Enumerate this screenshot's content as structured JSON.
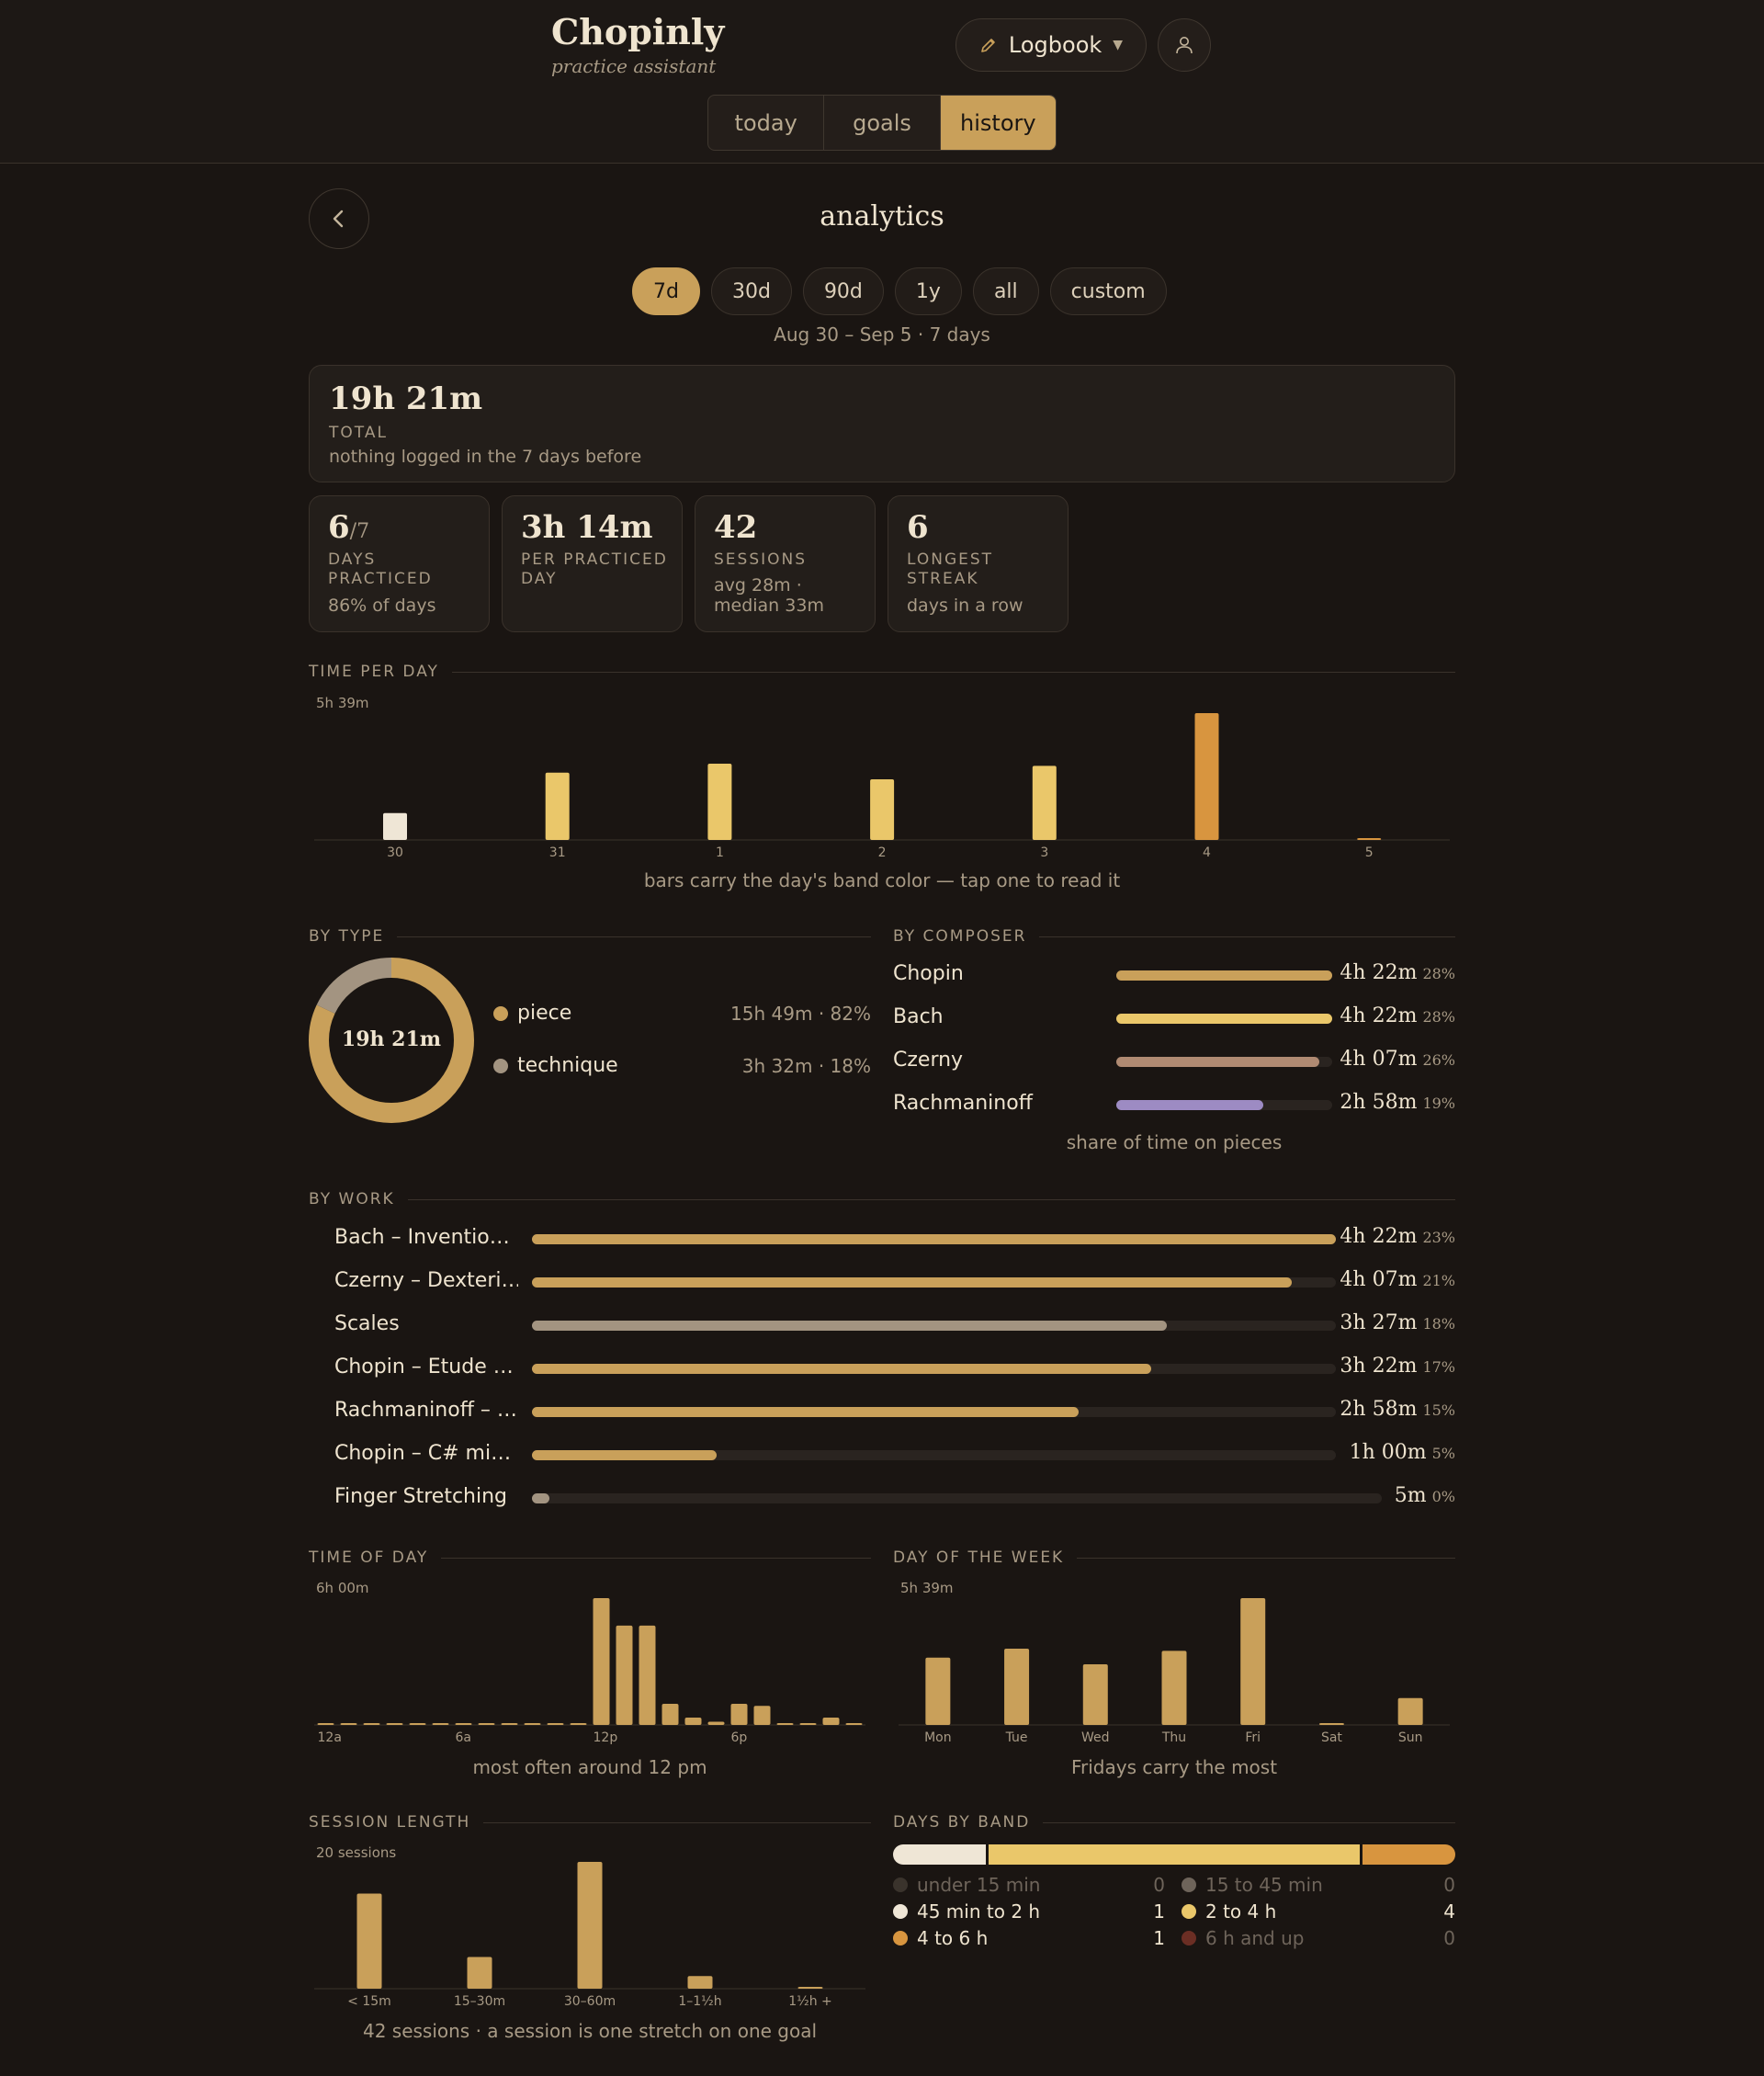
{
  "app": {
    "title": "Chopinly",
    "subtitle": "practice assistant"
  },
  "header": {
    "logbook_label": "Logbook",
    "tabs": [
      "today",
      "goals",
      "history"
    ],
    "active_tab": "history"
  },
  "page": {
    "title": "analytics",
    "range_options": [
      "7d",
      "30d",
      "90d",
      "1y",
      "all",
      "custom"
    ],
    "active_range": "7d",
    "date_range": "Aug 30 – Sep 5 · 7 days"
  },
  "total": {
    "value": "19h 21m",
    "label": "TOTAL",
    "note": "nothing logged in the 7 days before"
  },
  "stats": [
    {
      "value": "6",
      "suffix": "/7",
      "label": "DAYS PRACTICED",
      "note": "86% of days"
    },
    {
      "value": "3h 14m",
      "suffix": "",
      "label": "PER PRACTICED DAY",
      "note": ""
    },
    {
      "value": "42",
      "suffix": "",
      "label": "SESSIONS",
      "note": "avg 28m · median 33m"
    },
    {
      "value": "6",
      "suffix": "",
      "label": "LONGEST STREAK",
      "note": "days in a row"
    }
  ],
  "time_per_day": {
    "title": "TIME PER DAY",
    "max_label": "5h 39m",
    "caption": "bars carry the day's band color — tap one to read it",
    "chart_data": {
      "type": "bar",
      "categories": [
        "30",
        "31",
        "1",
        "2",
        "3",
        "4",
        "5"
      ],
      "values": [
        1.2,
        3.0,
        3.4,
        2.7,
        3.3,
        5.65,
        0.05
      ],
      "ylim": [
        0,
        5.65
      ],
      "colors": [
        "#efe6d6",
        "#eac76a",
        "#eac76a",
        "#eac76a",
        "#eac76a",
        "#d8953f",
        "#d8953f"
      ]
    }
  },
  "by_type": {
    "title": "BY TYPE",
    "center": "19h 21m",
    "items": [
      {
        "name": "piece",
        "value": "15h 49m · 82%",
        "color": "#c9a05a",
        "share": 82
      },
      {
        "name": "technique",
        "value": "3h 32m · 18%",
        "color": "#a39481",
        "share": 18
      }
    ]
  },
  "by_composer": {
    "title": "BY COMPOSER",
    "caption": "share of time on pieces",
    "items": [
      {
        "name": "Chopin",
        "time": "4h 22m",
        "pct": "28%",
        "fraction": 1.0,
        "color": "#c9a05a"
      },
      {
        "name": "Bach",
        "time": "4h 22m",
        "pct": "28%",
        "fraction": 1.0,
        "color": "#eac76a"
      },
      {
        "name": "Czerny",
        "time": "4h 07m",
        "pct": "26%",
        "fraction": 0.94,
        "color": "#b08a72"
      },
      {
        "name": "Rachmaninoff",
        "time": "2h 58m",
        "pct": "19%",
        "fraction": 0.68,
        "color": "#9d8bc3"
      }
    ]
  },
  "by_work": {
    "title": "BY WORK",
    "items": [
      {
        "name": "Bach – Inventio…",
        "time": "4h 22m",
        "pct": "23%",
        "fraction": 1.0,
        "color": "#c9a05a"
      },
      {
        "name": "Czerny – Dexteri…",
        "time": "4h 07m",
        "pct": "21%",
        "fraction": 0.945,
        "color": "#c9a05a"
      },
      {
        "name": "Scales",
        "time": "3h 27m",
        "pct": "18%",
        "fraction": 0.79,
        "color": "#a39481"
      },
      {
        "name": "Chopin – Etude …",
        "time": "3h 22m",
        "pct": "17%",
        "fraction": 0.77,
        "color": "#c9a05a"
      },
      {
        "name": "Rachmaninoff – …",
        "time": "2h 58m",
        "pct": "15%",
        "fraction": 0.68,
        "color": "#c9a05a"
      },
      {
        "name": "Chopin – C# mi…",
        "time": "1h 00m",
        "pct": "5%",
        "fraction": 0.23,
        "color": "#c9a05a"
      },
      {
        "name": "Finger Stretching",
        "time": "5m",
        "pct": "0%",
        "fraction": 0.02,
        "color": "#a39481"
      }
    ]
  },
  "time_of_day": {
    "title": "TIME OF DAY",
    "max_label": "6h 00m",
    "caption": "most often around 12 pm",
    "chart_data": {
      "type": "bar",
      "categories": [
        "12a",
        "1a",
        "2a",
        "3a",
        "4a",
        "5a",
        "6a",
        "7a",
        "8a",
        "9a",
        "10a",
        "11a",
        "12p",
        "1p",
        "2p",
        "3p",
        "4p",
        "5p",
        "6p",
        "7p",
        "8p",
        "9p",
        "10p",
        "11p"
      ],
      "tick_labels": {
        "0": "12a",
        "6": "6a",
        "12": "12p",
        "18": "6p"
      },
      "values": [
        0.05,
        0.05,
        0.05,
        0.05,
        0.05,
        0.05,
        0.05,
        0.05,
        0.05,
        0.05,
        0.05,
        0.05,
        6.0,
        4.7,
        4.7,
        1.0,
        0.35,
        0.15,
        1.0,
        0.9,
        0.05,
        0.05,
        0.35,
        0.05
      ],
      "ylim": [
        0,
        6.0
      ]
    }
  },
  "day_of_week": {
    "title": "DAY OF THE WEEK",
    "max_label": "5h 39m",
    "caption": "Fridays carry the most",
    "chart_data": {
      "type": "bar",
      "categories": [
        "Mon",
        "Tue",
        "Wed",
        "Thu",
        "Fri",
        "Sat",
        "Sun"
      ],
      "values": [
        3.0,
        3.4,
        2.7,
        3.3,
        5.65,
        0.05,
        1.2
      ],
      "ylim": [
        0,
        5.65
      ]
    }
  },
  "session_length": {
    "title": "SESSION LENGTH",
    "max_label": "20 sessions",
    "caption": "42 sessions · a session is one stretch on one goal",
    "chart_data": {
      "type": "bar",
      "categories": [
        "< 15m",
        "15–30m",
        "30–60m",
        "1–1½h",
        "1½h +"
      ],
      "values": [
        15,
        5,
        20,
        2,
        0.2
      ],
      "ylim": [
        0,
        20
      ]
    }
  },
  "days_by_band": {
    "title": "DAYS BY BAND",
    "bar": [
      {
        "fraction": 0.1667,
        "color": "#efe6d6"
      },
      {
        "fraction": 0.6667,
        "color": "#eac76a"
      },
      {
        "fraction": 0.1667,
        "color": "#d8953f"
      }
    ],
    "items": [
      {
        "name": "under 15 min",
        "count": "0",
        "color": "#3a332c",
        "dim": true
      },
      {
        "name": "15 to 45 min",
        "count": "0",
        "color": "#6e645a",
        "dim": true
      },
      {
        "name": "45 min to 2 h",
        "count": "1",
        "color": "#efe6d6",
        "dim": false
      },
      {
        "name": "2 to 4 h",
        "count": "4",
        "color": "#eac76a",
        "dim": false
      },
      {
        "name": "4 to 6 h",
        "count": "1",
        "color": "#d8953f",
        "dim": false
      },
      {
        "name": "6 h and up",
        "count": "0",
        "color": "#6b2e24",
        "dim": true
      }
    ]
  }
}
